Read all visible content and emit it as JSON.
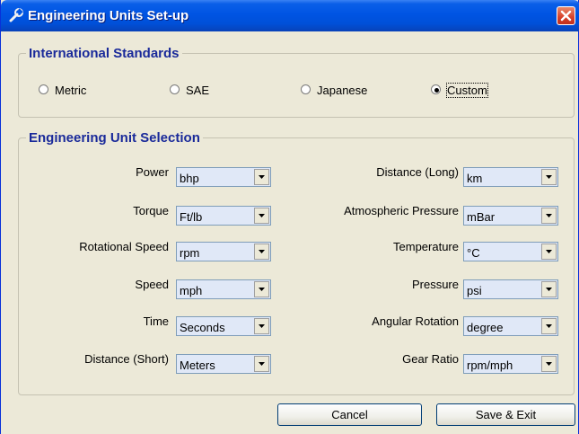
{
  "window": {
    "title": "Engineering Units Set-up"
  },
  "standards": {
    "legend": "International Standards",
    "options": [
      {
        "label": "Metric",
        "selected": false
      },
      {
        "label": "SAE",
        "selected": false
      },
      {
        "label": "Japanese",
        "selected": false
      },
      {
        "label": "Custom",
        "selected": true
      }
    ]
  },
  "units": {
    "legend": "Engineering Unit Selection",
    "left": [
      {
        "label": "Power",
        "value": "bhp"
      },
      {
        "label": "Torque",
        "value": "Ft/lb"
      },
      {
        "label": "Rotational Speed",
        "value": "rpm"
      },
      {
        "label": "Speed",
        "value": "mph"
      },
      {
        "label": "Time",
        "value": "Seconds"
      },
      {
        "label": "Distance (Short)",
        "value": "Meters"
      }
    ],
    "right": [
      {
        "label": "Distance (Long)",
        "value": "km"
      },
      {
        "label": "Atmospheric Pressure",
        "value": "mBar"
      },
      {
        "label": "Temperature",
        "value": "°C"
      },
      {
        "label": "Pressure",
        "value": "psi"
      },
      {
        "label": "Angular Rotation",
        "value": "degree"
      },
      {
        "label": "Gear Ratio",
        "value": "rpm/mph"
      }
    ]
  },
  "buttons": {
    "cancel": "Cancel",
    "save": "Save & Exit"
  },
  "colors": {
    "title_bar": "#0054e3",
    "legend_text": "#1a2a9a",
    "dialog_bg": "#ece9d8",
    "close_button": "#d8402a"
  }
}
